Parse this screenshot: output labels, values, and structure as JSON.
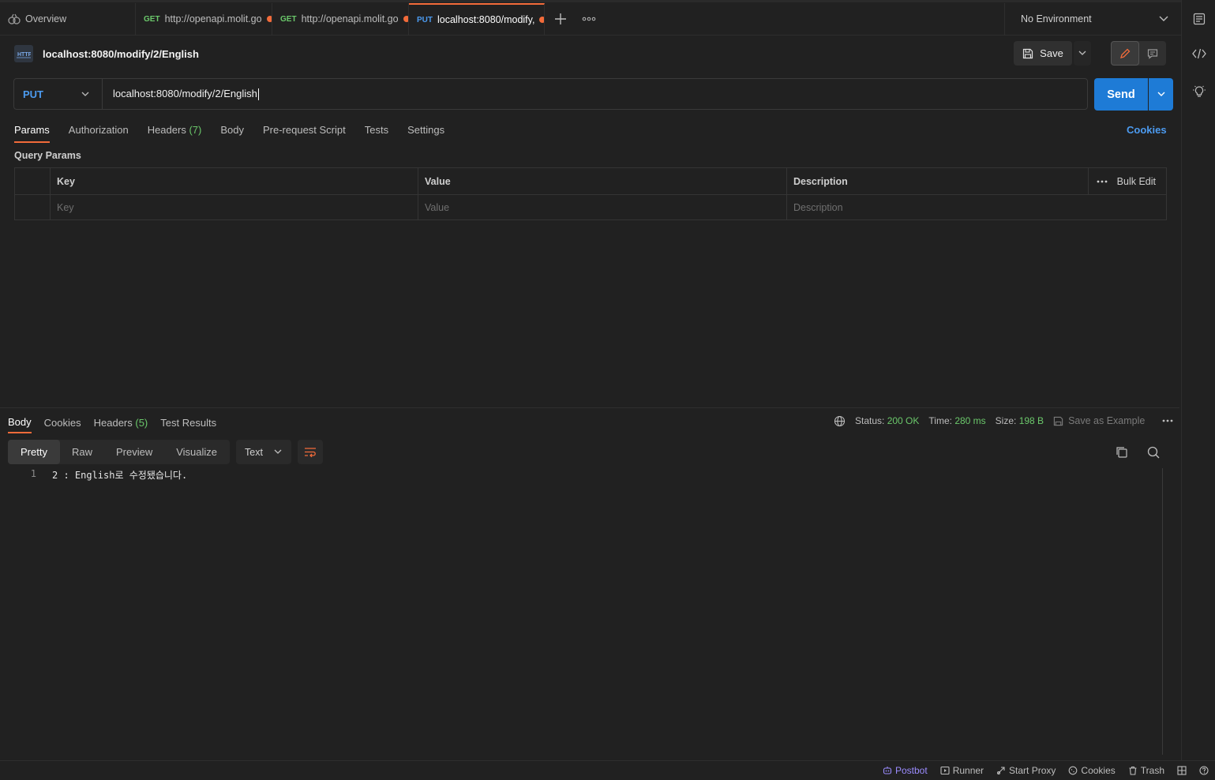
{
  "tabs": [
    {
      "label": "Overview",
      "method": "",
      "icon": "overview-icon",
      "unsaved": false
    },
    {
      "label": "http://openapi.molit.go",
      "method": "GET",
      "unsaved": true
    },
    {
      "label": "http://openapi.molit.go",
      "method": "GET",
      "unsaved": true
    },
    {
      "label": "localhost:8080/modify,",
      "method": "PUT",
      "unsaved": true,
      "active": true
    }
  ],
  "environment": {
    "label": "No Environment"
  },
  "request": {
    "title": "localhost:8080/modify/2/English",
    "badge": "HTTP",
    "method": "PUT",
    "url": "localhost:8080/modify/2/English",
    "save_label": "Save",
    "send_label": "Send"
  },
  "request_tabs": {
    "params": "Params",
    "authorization": "Authorization",
    "headers": "Headers",
    "headers_count": "(7)",
    "body": "Body",
    "prerequest": "Pre-request Script",
    "tests": "Tests",
    "settings": "Settings",
    "cookies": "Cookies"
  },
  "query_params": {
    "label": "Query Params",
    "headers": {
      "key": "Key",
      "value": "Value",
      "description": "Description",
      "bulk_edit": "Bulk Edit"
    },
    "placeholders": {
      "key": "Key",
      "value": "Value",
      "description": "Description"
    }
  },
  "response": {
    "tabs": {
      "body": "Body",
      "cookies": "Cookies",
      "headers": "Headers",
      "headers_count": "(5)",
      "test_results": "Test Results"
    },
    "status_label": "Status:",
    "status_value": "200 OK",
    "time_label": "Time:",
    "time_value": "280 ms",
    "size_label": "Size:",
    "size_value": "198 B",
    "save_example": "Save as Example",
    "view_tabs": {
      "pretty": "Pretty",
      "raw": "Raw",
      "preview": "Preview",
      "visualize": "Visualize"
    },
    "format": "Text",
    "lines": [
      {
        "n": "1",
        "text": "2 : English로 수정됐습니다."
      }
    ]
  },
  "statusbar": {
    "postbot": "Postbot",
    "runner": "Runner",
    "start_proxy": "Start Proxy",
    "cookies": "Cookies",
    "trash": "Trash"
  },
  "colors": {
    "accent": "#f26b3a",
    "send": "#1e7bd6",
    "put": "#4c9bf0",
    "get": "#6bc86b",
    "ok": "#6bc86b"
  }
}
